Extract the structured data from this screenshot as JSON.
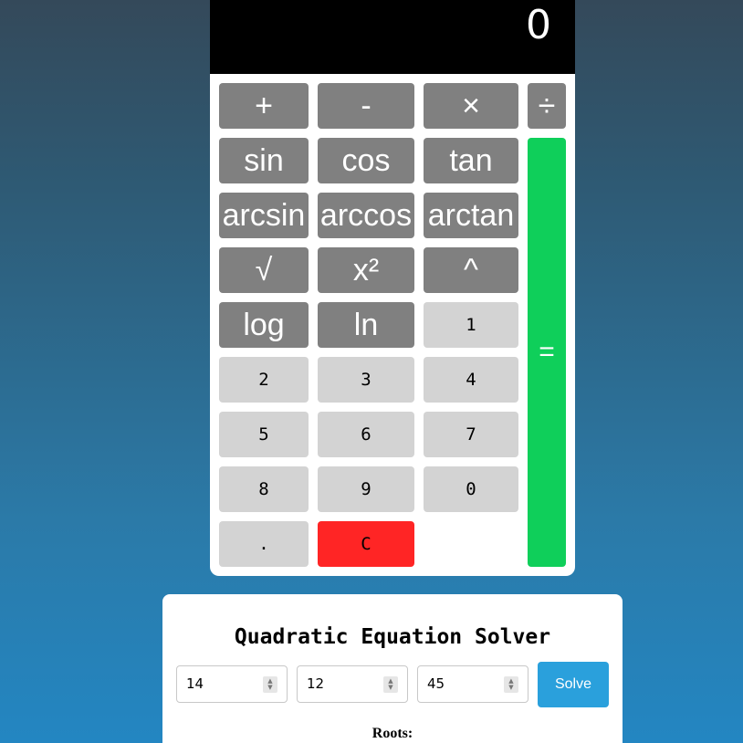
{
  "calculator": {
    "display": "0",
    "keys": {
      "plus": "+",
      "minus": "-",
      "multiply": "×",
      "divide": "÷",
      "sin": "sin",
      "cos": "cos",
      "tan": "tan",
      "arcsin": "arcsin",
      "arccos": "arccos",
      "arctan": "arctan",
      "sqrt": "√",
      "square": "x²",
      "power": "^",
      "log": "log",
      "ln": "ln",
      "d1": "1",
      "d2": "2",
      "d3": "3",
      "d4": "4",
      "d5": "5",
      "d6": "6",
      "d7": "7",
      "d8": "8",
      "d9": "9",
      "d0": "0",
      "dot": ".",
      "clear": "C",
      "equals": "="
    }
  },
  "solver": {
    "title": "Quadratic Equation Solver",
    "a_value": "14",
    "b_value": "12",
    "c_value": "45",
    "solve_label": "Solve",
    "roots_label": "Roots:"
  },
  "colors": {
    "operator_key": "#808080",
    "digit_key": "#d3d3d3",
    "clear_key": "#ff2525",
    "equals_key": "#0fcf5a",
    "solve_button": "#2aa0dc"
  }
}
